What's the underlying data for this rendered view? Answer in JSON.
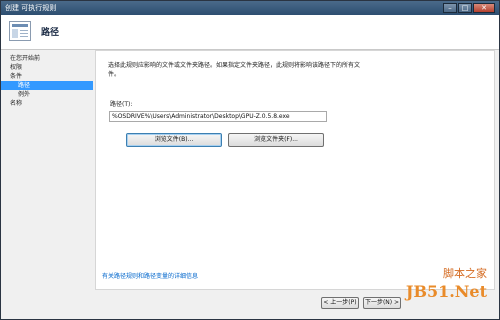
{
  "window": {
    "title": "创建 可执行规则",
    "minimize_glyph": "–",
    "maximize_glyph": "□",
    "close_glyph": "✕"
  },
  "header": {
    "title": "路径",
    "icon": "wizard-page-icon"
  },
  "sidebar": {
    "items": [
      {
        "label": "在您开始前"
      },
      {
        "label": "权限"
      },
      {
        "label": "条件"
      },
      {
        "label": "路径",
        "selected": true
      },
      {
        "label": "例外"
      },
      {
        "label": "名称"
      }
    ]
  },
  "main": {
    "description": "选择此规则应影响的文件或文件夹路径。如果指定文件夹路径，此规则将影响该路径下的所有文件。",
    "path_label": "路径(T):",
    "path_value": "%OSDRIVE%\\Users\\Administrator\\Desktop\\GPU-Z.0.5.8.exe",
    "browse_files_label": "浏览文件(B)...",
    "browse_folders_label": "浏览文件夹(F)...",
    "help_link": "有关路径规则和路径变量的详细信息"
  },
  "footer": {
    "back_label": "< 上一步(P)",
    "next_label": "下一步(N) >"
  },
  "watermark": {
    "line1": "脚本之家",
    "line2": "JB51.Net"
  },
  "colors": {
    "selection": "#3399ff",
    "link": "#0066cc",
    "titlebar": "#2d4e70",
    "watermark": "#e98b2a"
  }
}
